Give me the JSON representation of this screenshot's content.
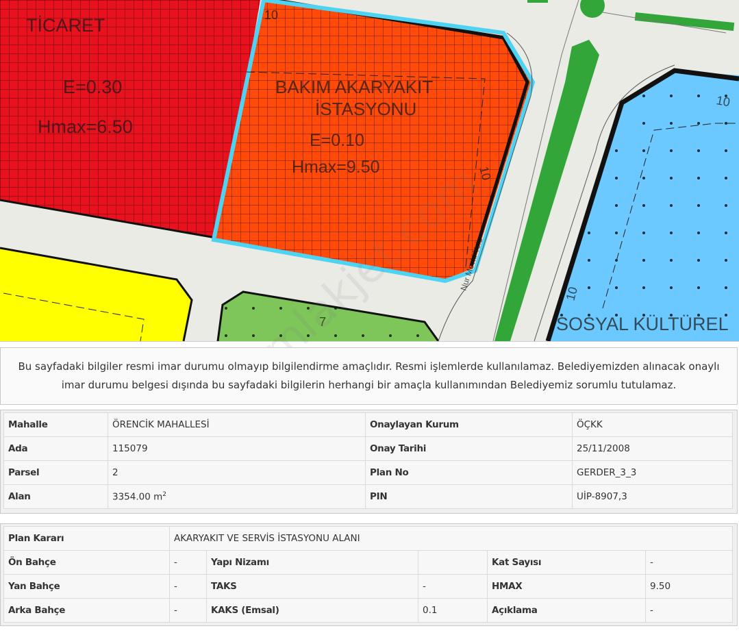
{
  "map": {
    "zones": [
      {
        "label": "TİCARET",
        "e": "E=0.30",
        "hmax": "Hmax=6.50",
        "color": "#e8111e"
      },
      {
        "label_line1": "BAKIM AKARYAKIT",
        "label_line2": "İSTASYONU",
        "e": "E=0.10",
        "hmax": "Hmax=9.50",
        "color": "#ff4a0a"
      },
      {
        "label": "SOSYAL KÜLTÜREL",
        "color": "#6cc9ff"
      }
    ],
    "dimensions": [
      "10",
      "10",
      "10",
      "10",
      "7"
    ],
    "road_name": "Nur Mevki Yolu",
    "colors": {
      "highlight": "#4fd3f2",
      "park": "#7ec55a",
      "yellow": "#ffff00",
      "road": "#ebebe6"
    }
  },
  "watermark": "emlakjet.com",
  "disclaimer": {
    "line1": "Bu sayfadaki bilgiler resmi imar durumu olmayıp bilgilendirme amaçlıdır. Resmi işlemlerde kullanılamaz. Belediyemizden alınacak onaylı",
    "line2": "imar durumu belgesi dışında bu sayfadaki bilgilerin herhangi bir amaçla kullanımından Belediyemiz sorumlu tutulamaz."
  },
  "parcel": {
    "rows": [
      {
        "k1": "Mahalle",
        "v1": "ÖRENCİK MAHALLESİ",
        "k2": "Onaylayan Kurum",
        "v2": "ÖÇKK"
      },
      {
        "k1": "Ada",
        "v1": "115079",
        "k2": "Onay Tarihi",
        "v2": "25/11/2008"
      },
      {
        "k1": "Parsel",
        "v1": "2",
        "k2": "Plan No",
        "v2": "GERDER_3_3"
      },
      {
        "k1": "Alan",
        "v1": "3354.00 m",
        "v1_sup": "2",
        "k2": "PIN",
        "v2": "UİP-8907,3"
      }
    ]
  },
  "plan": {
    "decision_label": "Plan Kararı",
    "decision_value": "AKARYAKIT VE SERVİS İSTASYONU ALANI",
    "rows": [
      {
        "k1": "Ön Bahçe",
        "v1": "-",
        "k2": "Yapı Nizamı",
        "v2": "",
        "k3": "Kat Sayısı",
        "v3": "-"
      },
      {
        "k1": "Yan Bahçe",
        "v1": "-",
        "k2": "TAKS",
        "v2": "-",
        "k3": "HMAX",
        "v3": "9.50"
      },
      {
        "k1": "Arka Bahçe",
        "v1": "-",
        "k2": "KAKS (Emsal)",
        "v2": "0.1",
        "k3": "Açıklama",
        "v3": "-"
      }
    ]
  }
}
